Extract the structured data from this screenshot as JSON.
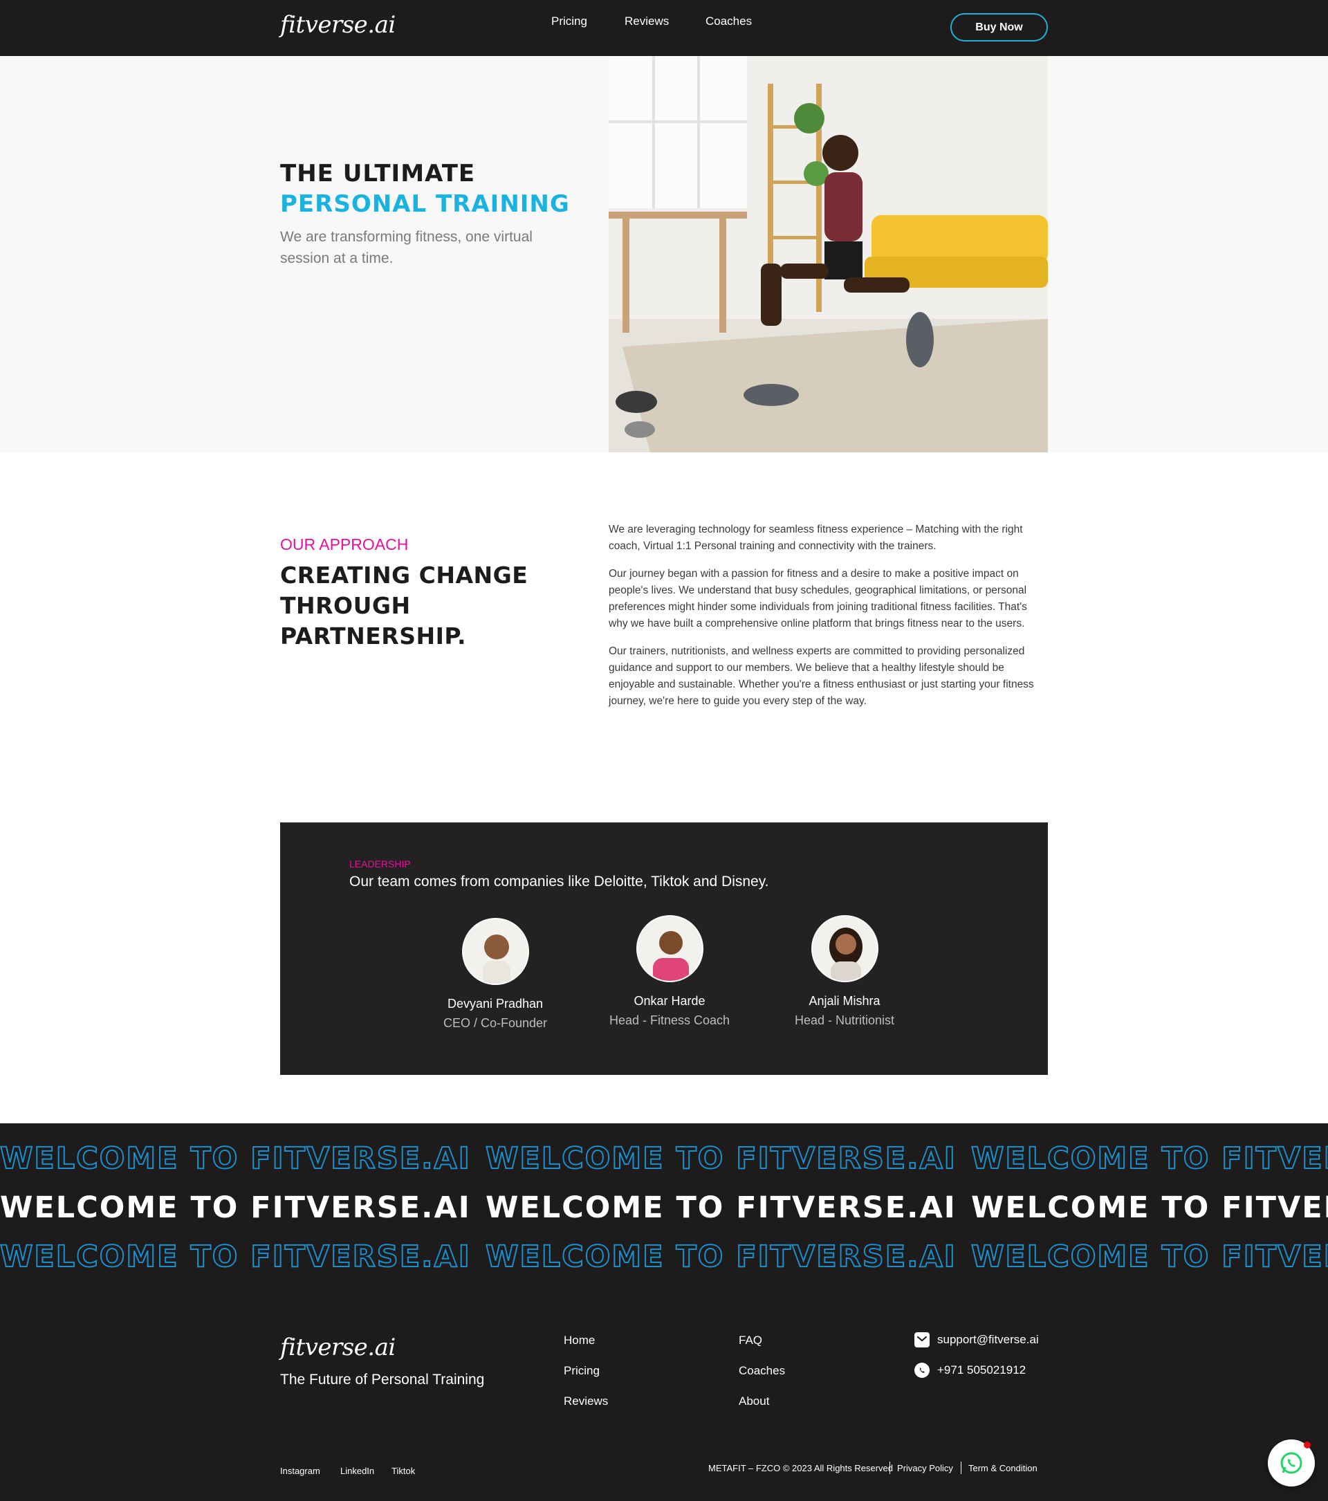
{
  "brand": {
    "logo": "fitverse.ai",
    "accent": "#1ab3e0",
    "pink": "#e5139a"
  },
  "nav": {
    "links": [
      "Pricing",
      "Reviews",
      "Coaches"
    ],
    "cta": "Buy Now"
  },
  "hero": {
    "title_line1": "THE ULTIMATE",
    "title_line2": "PERSONAL TRAINING",
    "subtitle": "We are transforming fitness, one virtual session at a time."
  },
  "approach": {
    "eyebrow": "OUR APPROACH",
    "title": "CREATING CHANGE THROUGH PARTNERSHIP.",
    "paragraphs": [
      "We are leveraging technology for seamless fitness experience – Matching with the right coach, Virtual 1:1 Personal training and connectivity with the trainers.",
      "Our journey began with a passion for fitness and a desire to make a positive impact on people's lives. We understand that busy schedules, geographical limitations, or personal preferences might hinder some individuals from joining traditional fitness facilities. That's why we have built a comprehensive online platform that brings fitness near to the users.",
      "Our trainers, nutritionists, and wellness experts are committed to providing personalized guidance and support to our members. We believe that a healthy lifestyle should be enjoyable and sustainable. Whether you're a fitness enthusiast or just starting your fitness journey, we're here to guide you every step of the way."
    ]
  },
  "leadership": {
    "eyebrow": "LEADERSHIP",
    "headline": "Our team comes from companies like Deloitte, Tiktok and Disney.",
    "members": [
      {
        "name": "Devyani Pradhan",
        "role": "CEO / Co-Founder"
      },
      {
        "name": "Onkar Harde",
        "role": "Head - Fitness Coach"
      },
      {
        "name": "Anjali Mishra",
        "role": "Head - Nutritionist"
      }
    ]
  },
  "marquee": {
    "text": "WELCOME TO FITVERSE.AI"
  },
  "footer": {
    "logo": "fitverse.ai",
    "tagline": "The Future of Personal Training",
    "col1": [
      "Home",
      "Pricing",
      "Reviews"
    ],
    "col2": [
      "FAQ",
      "Coaches",
      "About"
    ],
    "email": "support@fitverse.ai",
    "phone": "+971 505021912",
    "social": [
      "Instagram",
      "LinkedIn",
      "Tiktok"
    ],
    "copyright": "METAFIT – FZCO © 2023 All Rights Reserved",
    "privacy": "Privacy Policy",
    "terms": "Term & Condition"
  }
}
